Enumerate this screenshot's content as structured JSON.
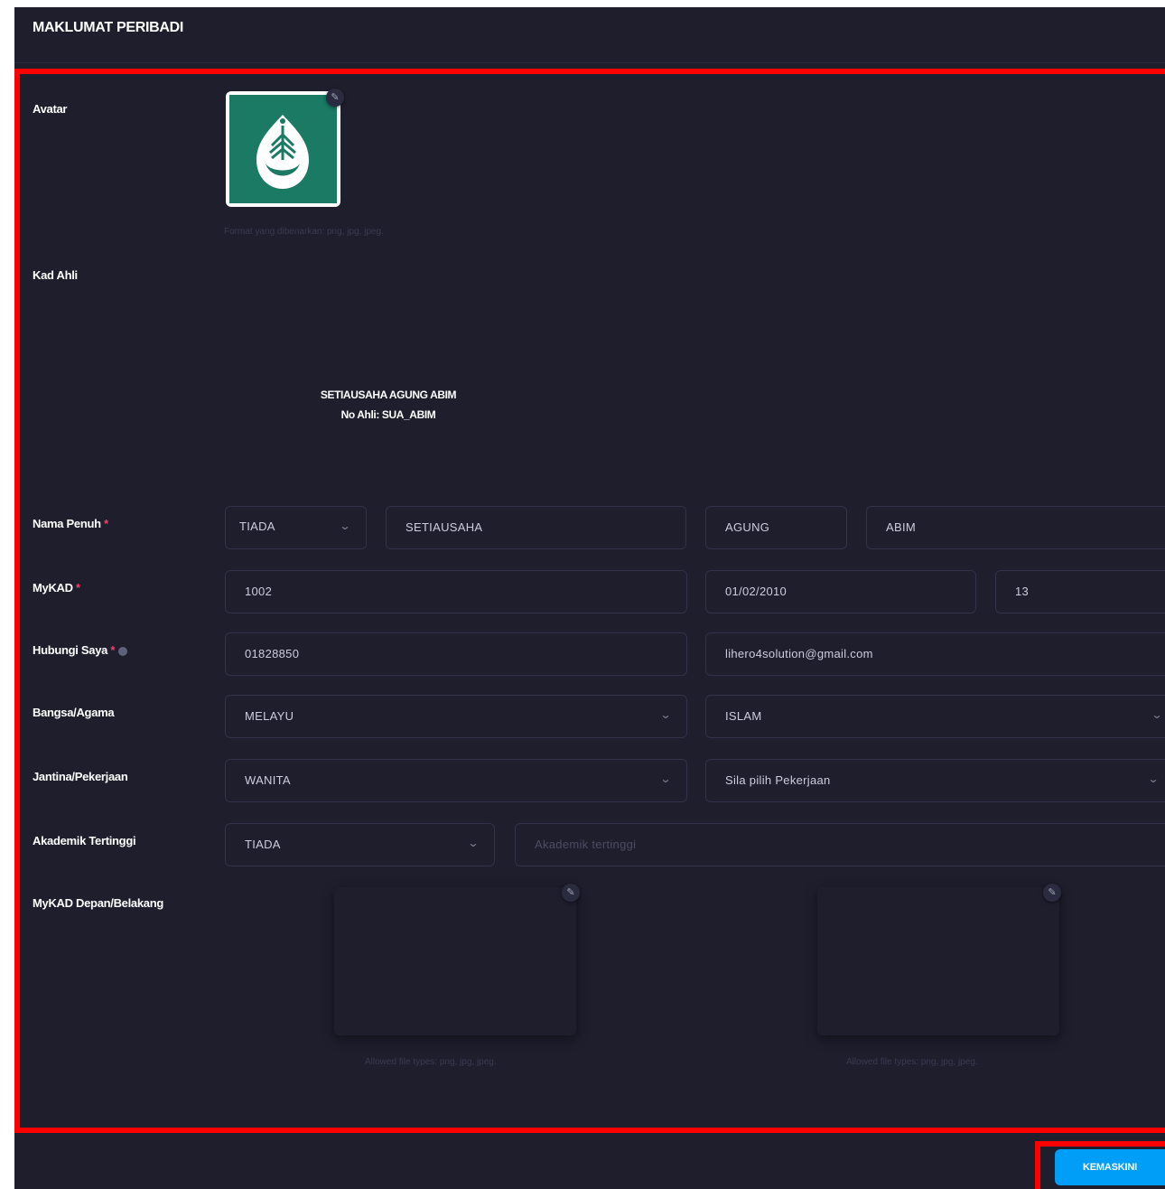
{
  "header": {
    "title": "MAKLUMAT PERIBADI"
  },
  "avatar": {
    "label": "Avatar",
    "hint": "Format yang dibenarkan: png, jpg, jpeg.",
    "edit_icon": "pencil-icon"
  },
  "member_card": {
    "label": "Kad Ahli",
    "name": "SETIAUSAHA AGUNG ABIM",
    "no_ahli_label": "No Ahli: ",
    "no_ahli_value": "SUA_ABIM"
  },
  "full_name": {
    "label": "Nama Penuh",
    "required_mark": "*",
    "title_value": "TIADA",
    "first_name": "SETIAUSAHA",
    "middle_name": "AGUNG",
    "last_name": "ABIM"
  },
  "mykad": {
    "label": "MyKAD",
    "required_mark": "*",
    "number": "1002",
    "birth_date": "01/02/2010",
    "age": "13"
  },
  "contact": {
    "label": "Hubungi Saya",
    "required_mark": "*",
    "phone": "01828850",
    "email": "lihero4solution@gmail.com"
  },
  "race_religion": {
    "label": "Bangsa/Agama",
    "race": "MELAYU",
    "religion": "ISLAM"
  },
  "gender_job": {
    "label": "Jantina/Pekerjaan",
    "gender": "WANITA",
    "job_placeholder": "Sila pilih Pekerjaan"
  },
  "academic": {
    "label": "Akademik Tertinggi",
    "level": "TIADA",
    "placeholder": "Akademik tertinggi"
  },
  "mykad_images": {
    "label": "MyKAD Depan/Belakang",
    "front_hint": "Allowed file types: png, jpg, jpeg.",
    "back_hint": "Allowed file types: png, jpg, jpeg."
  },
  "footer": {
    "submit_label": "KEMASKINI"
  },
  "colors": {
    "background": "#1e1e2d",
    "border": "#323248",
    "accent": "#009ef7",
    "required": "#f1416c",
    "highlight": "#ff0000",
    "logo_bg": "#1a7a64"
  }
}
